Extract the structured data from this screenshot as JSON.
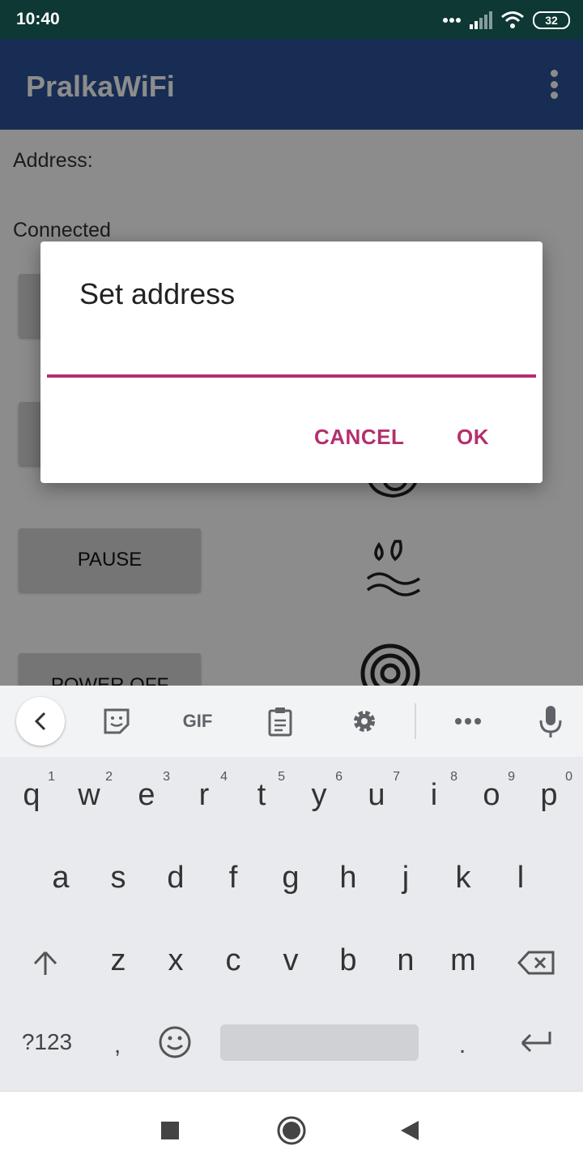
{
  "status_bar": {
    "time": "10:40",
    "battery": "32"
  },
  "app_bar": {
    "title": "PralkaWiFi"
  },
  "content": {
    "address_label": "Address:",
    "connection_status": "Connected",
    "pause_label": "PAUSE",
    "power_off_label": "POWER OFF"
  },
  "dialog": {
    "title": "Set address",
    "input_value": "",
    "cancel_label": "CANCEL",
    "ok_label": "OK"
  },
  "keyboard": {
    "toolbar": {
      "gif_label": "GIF"
    },
    "row1": [
      {
        "key": "q",
        "hint": "1"
      },
      {
        "key": "w",
        "hint": "2"
      },
      {
        "key": "e",
        "hint": "3"
      },
      {
        "key": "r",
        "hint": "4"
      },
      {
        "key": "t",
        "hint": "5"
      },
      {
        "key": "y",
        "hint": "6"
      },
      {
        "key": "u",
        "hint": "7"
      },
      {
        "key": "i",
        "hint": "8"
      },
      {
        "key": "o",
        "hint": "9"
      },
      {
        "key": "p",
        "hint": "0"
      }
    ],
    "row2": [
      "a",
      "s",
      "d",
      "f",
      "g",
      "h",
      "j",
      "k",
      "l"
    ],
    "row3": [
      "z",
      "x",
      "c",
      "v",
      "b",
      "n",
      "m"
    ],
    "symbols_label": "?123",
    "comma": ",",
    "period": "."
  },
  "colors": {
    "status_bar": "#0d3834",
    "app_bar": "#2a5298",
    "accent": "#b3306e"
  }
}
